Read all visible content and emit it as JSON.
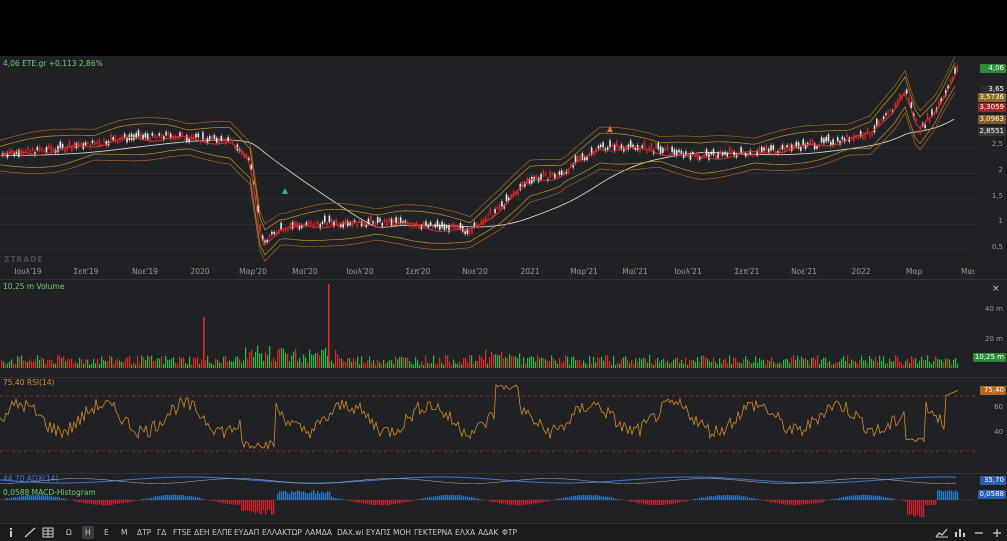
{
  "main": {
    "label": "4,06 ETE.gr +0,113 2,86%",
    "watermark": "ZTRADE",
    "price_badges": [
      {
        "value": "4,06",
        "color": "#2e8b3a"
      },
      {
        "value": "3,65",
        "color": "#2a2c30"
      },
      {
        "value": "3,5736",
        "color": "#8a6a1e"
      },
      {
        "value": "3,3059",
        "color": "#a0262a"
      },
      {
        "value": "3,0963",
        "color": "#8a5a1e"
      },
      {
        "value": "2,8551",
        "color": "#3a3a3a"
      }
    ],
    "y_ticks": [
      "2,5",
      "2",
      "1,5",
      "1",
      "0,5"
    ],
    "x_ticks": [
      "Ιουλ'19",
      "Σεπ'19",
      "Νοε'19",
      "2020",
      "Μαρ'20",
      "Μαϊ'20",
      "Ιουλ'20",
      "Σεπ'20",
      "Νοε'20",
      "2021",
      "Μαρ'21",
      "Μαϊ'21",
      "Ιουλ'21",
      "Σεπ'21",
      "Νοε'21",
      "2022",
      "Μαρ",
      "Μαι"
    ]
  },
  "volume": {
    "label": "10,25 m Volume",
    "badge": "10,25 m",
    "ticks": [
      "40 m",
      "20 m"
    ],
    "close": "×"
  },
  "rsi": {
    "label": "75,40 RSI(14)",
    "badge": "75,40",
    "ticks": [
      "60",
      "40"
    ]
  },
  "adx": {
    "label": "44,70 ADX(14)",
    "badge": "35,70"
  },
  "macd": {
    "label": "0,0588 MACD-Histogram",
    "badge": "0,0588"
  },
  "toolbar": {
    "items": [
      "Ω",
      "Η",
      "Ε",
      "Μ",
      "ΔΤΡ",
      "ΓΔ",
      "FTSE",
      "ΔΕΗ",
      "ΕΛΠΕ",
      "ΕΥΔΑΠ",
      "ΕΛΛΑΚΤΩΡ",
      "ΛΑΜΔΑ",
      "DAX.wi",
      "ΕΥΑΠΣ",
      "ΜΟΗ",
      "ΓΕΚΤΕΡΝΑ",
      "ΕΛΧΑ",
      "ΑΔΑΚ",
      "ΦΤΡ"
    ]
  },
  "colors": {
    "up": "#2fb84a",
    "down": "#e02a2a",
    "rsi": "#d98a2e",
    "ma_long": "#d8d2c0",
    "adx": "#3a7bd5",
    "macd_pos": "#2a7fd4",
    "macd_neg": "#d4202a"
  },
  "icons": [
    "info-icon",
    "draw-line-icon",
    "grid-icon",
    "chart-type-icon",
    "indicators-icon",
    "zoom-out-icon",
    "zoom-in-icon"
  ]
}
